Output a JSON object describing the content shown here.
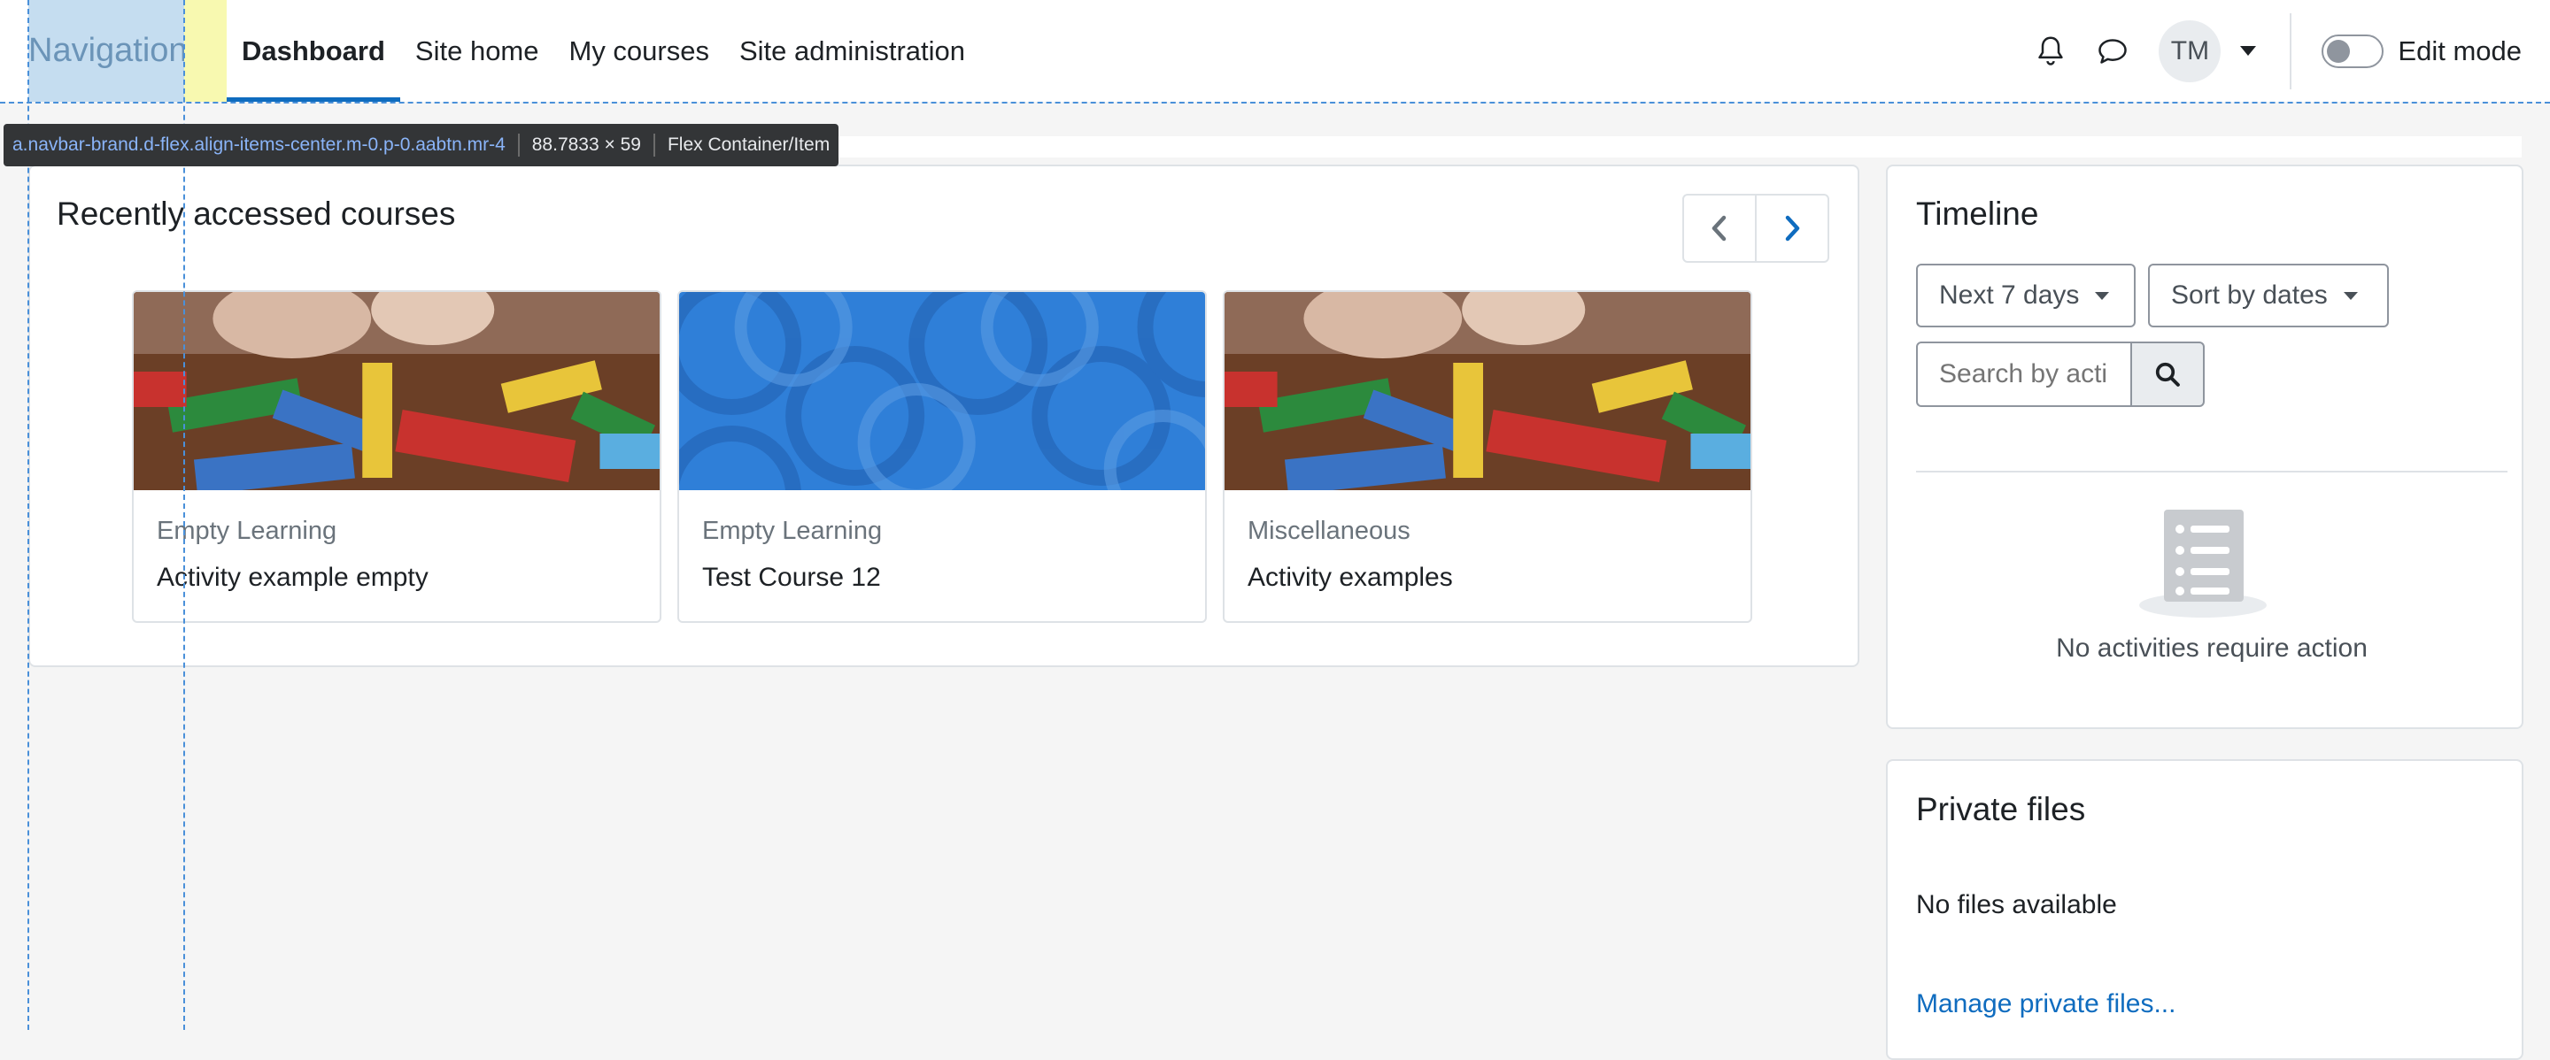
{
  "navbar": {
    "brand": "Navigation",
    "items": [
      {
        "label": "Dashboard"
      },
      {
        "label": "Site home"
      },
      {
        "label": "My courses"
      },
      {
        "label": "Site administration"
      }
    ],
    "user_initials": "TM",
    "edit_mode_label": "Edit mode",
    "icons": [
      "bell-icon",
      "chat-icon",
      "caret-down-icon"
    ]
  },
  "devtools": {
    "selector": "a.navbar-brand.d-flex.align-items-center.m-0.p-0.aabtn.mr-4",
    "size": "88.7833 × 59",
    "type": "Flex Container/Item"
  },
  "recent": {
    "title": "Recently accessed courses",
    "courses": [
      {
        "category": "Empty Learning",
        "name": "Activity example empty",
        "image": "toy-blocks"
      },
      {
        "category": "Empty Learning",
        "name": "Test Course 12",
        "image": "blue-pattern"
      },
      {
        "category": "Miscellaneous",
        "name": "Activity examples",
        "image": "toy-blocks"
      }
    ]
  },
  "timeline": {
    "title": "Timeline",
    "range_select": "Next 7 days",
    "sort_select": "Sort by dates",
    "search_placeholder": "Search by acti",
    "empty_message": "No activities require action"
  },
  "private_files": {
    "title": "Private files",
    "empty_message": "No files available",
    "manage_link": "Manage private files..."
  },
  "colors": {
    "accent": "#0f6cbf",
    "page_bg": "#f5f5f5",
    "border": "#dee2e6"
  }
}
